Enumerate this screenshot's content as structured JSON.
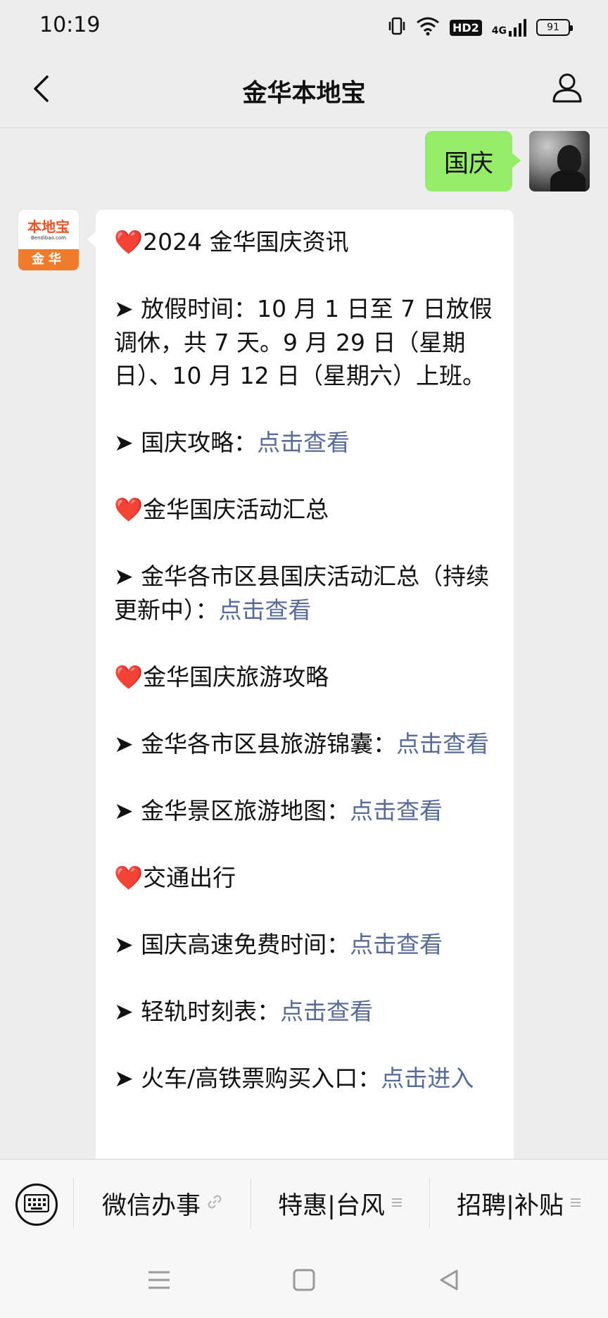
{
  "status_bar": {
    "time": "10:19",
    "network": "4G",
    "hd_badge": "HD2",
    "battery": "91"
  },
  "navbar": {
    "title": "金华本地宝",
    "back_icon": "back-chevron-icon",
    "user_icon": "person-icon"
  },
  "chat": {
    "user_message": "国庆",
    "bot_avatar": {
      "brand": "本地宝",
      "domain": "Bendibao.com",
      "city": "金华"
    },
    "bot_message": [
      {
        "prefix": "❤️",
        "text": "2024 金华国庆资讯",
        "link": ""
      },
      {
        "prefix": "➤ ",
        "text": "放假时间：10 月 1 日至 7 日放假调休，共 7 天。9 月 29 日（星期日）、10 月 12 日（星期六）上班。",
        "link": ""
      },
      {
        "prefix": "➤ ",
        "text": "国庆攻略：",
        "link": "点击查看"
      },
      {
        "prefix": "❤️",
        "text": "金华国庆活动汇总",
        "link": ""
      },
      {
        "prefix": "➤ ",
        "text": "金华各市区县国庆活动汇总（持续更新中）：",
        "link": "点击查看"
      },
      {
        "prefix": "❤️",
        "text": "金华国庆旅游攻略",
        "link": ""
      },
      {
        "prefix": "➤ ",
        "text": "金华各市区县旅游锦囊：",
        "link": "点击查看"
      },
      {
        "prefix": "➤ ",
        "text": "金华景区旅游地图：",
        "link": "点击查看"
      },
      {
        "prefix": "❤️",
        "text": "交通出行",
        "link": ""
      },
      {
        "prefix": "➤ ",
        "text": "国庆高速免费时间：",
        "link": "点击查看"
      },
      {
        "prefix": "➤ ",
        "text": "轻轨时刻表：",
        "link": "点击查看"
      },
      {
        "prefix": "➤ ",
        "text": "火车/高铁票购买入口：",
        "link": "点击进入"
      }
    ]
  },
  "menu_bar": {
    "items": [
      {
        "label": "微信办事",
        "icon": "link-icon"
      },
      {
        "label": "特惠|台风",
        "icon": "menu-lines-icon"
      },
      {
        "label": "招聘|补贴",
        "icon": "menu-lines-icon"
      }
    ],
    "keyboard_icon": "keyboard-icon"
  },
  "system_nav": {
    "recent_icon": "menu-icon",
    "home_icon": "home-square-icon",
    "back_icon": "back-triangle-icon"
  },
  "colors": {
    "background": "#ededed",
    "user_bubble": "#95ec69",
    "link": "#576b95",
    "heart": "#e0262b",
    "brand_orange": "#f07c2b"
  }
}
